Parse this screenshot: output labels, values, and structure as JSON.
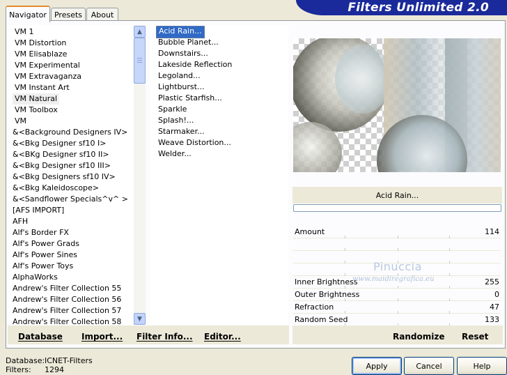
{
  "app": {
    "title": "Filters Unlimited 2.0"
  },
  "tabs": [
    {
      "label": "Navigator",
      "active": true
    },
    {
      "label": "Presets",
      "active": false
    },
    {
      "label": "About",
      "active": false
    }
  ],
  "categories": [
    "VM 1",
    "VM Distortion",
    "VM Elisablaze",
    "VM Experimental",
    "VM Extravaganza",
    "VM Instant Art",
    "VM Natural",
    "VM Toolbox",
    "VM",
    "&<Background Designers IV>",
    "&<Bkg Designer sf10 I>",
    "&<BKg Designer sf10 II>",
    "&<Bkg Designer sf10 III>",
    "&<Bkg Designers sf10 IV>",
    "&<Bkg Kaleidoscope>",
    "&<Sandflower Specials^v^ >",
    "[AFS IMPORT]",
    "AFH",
    "Alf's Border FX",
    "Alf's Power Grads",
    "Alf's Power Sines",
    "Alf's Power Toys",
    "AlphaWorks",
    "Andrew's Filter Collection 55",
    "Andrew's Filter Collection 56",
    "Andrew's Filter Collection 57",
    "Andrew's Filter Collection 58"
  ],
  "selected_category": "VM Natural",
  "filters": [
    "Acid Rain...",
    "Bubble Planet...",
    "Downstairs...",
    "Lakeside Reflection",
    "Legoland...",
    "Lightburst...",
    "Plastic Starfish...",
    "Sparkle",
    "Splash!...",
    "Starmaker...",
    "Weave Distortion...",
    "Welder..."
  ],
  "selected_filter": "Acid Rain...",
  "filter_name": "Acid Rain...",
  "params": [
    {
      "label": "Amount",
      "value": "114"
    },
    {
      "label": "",
      "value": ""
    },
    {
      "label": "",
      "value": ""
    },
    {
      "label": "",
      "value": ""
    },
    {
      "label": "Inner Brightness",
      "value": "255"
    },
    {
      "label": "Outer Brightness",
      "value": "0"
    },
    {
      "label": "Refraction",
      "value": "47"
    },
    {
      "label": "Random Seed",
      "value": "133"
    }
  ],
  "toolbar": {
    "database": "Database",
    "import": "Import...",
    "filter_info": "Filter Info...",
    "editor": "Editor...",
    "randomize": "Randomize",
    "reset": "Reset"
  },
  "status": {
    "database_label": "Database:",
    "database_value": "ICNET-Filters",
    "filters_label": "Filters:",
    "filters_value": "1294"
  },
  "buttons": {
    "apply": "Apply",
    "cancel": "Cancel",
    "help": "Help"
  },
  "watermark": {
    "line1": "Pinuccia",
    "line2": "www.maidiregrafica.eu"
  },
  "colors": {
    "banner": "#1a2a9a",
    "selection": "#316ac5",
    "tab_accent": "#e68b2c"
  }
}
